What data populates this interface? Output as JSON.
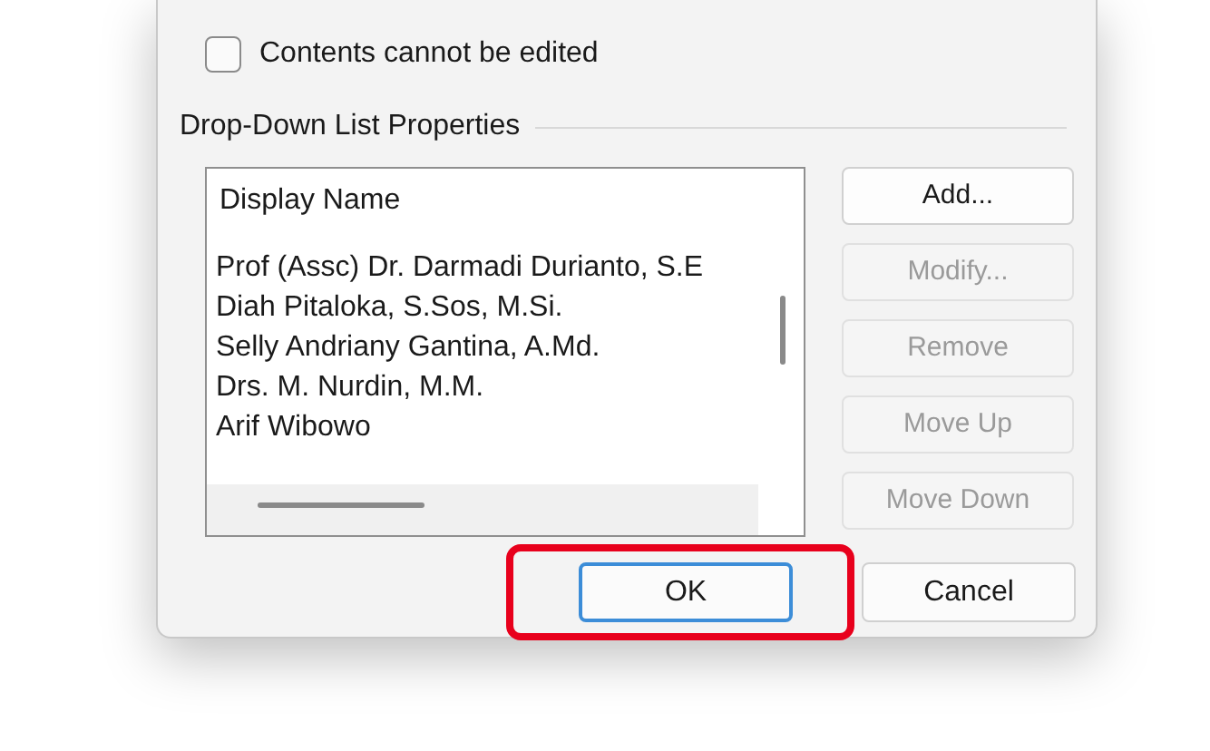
{
  "checkbox": {
    "label": "Contents cannot be edited",
    "checked": false
  },
  "group": {
    "title": "Drop-Down List Properties"
  },
  "list": {
    "header": "Display Name",
    "rows": [
      {
        "text": "Prof (Assc) Dr. Darmadi Durianto, S.E"
      },
      {
        "text": "Diah Pitaloka, S.Sos, M.Si."
      },
      {
        "text": "Selly Andriany Gantina, A.Md."
      },
      {
        "text": "Drs. M. Nurdin, M.M."
      },
      {
        "text": "Arif Wibowo"
      }
    ]
  },
  "side_buttons": [
    {
      "label": "Add...",
      "disabled": false
    },
    {
      "label": "Modify...",
      "disabled": true
    },
    {
      "label": "Remove",
      "disabled": true
    },
    {
      "label": "Move Up",
      "disabled": true
    },
    {
      "label": "Move Down",
      "disabled": true
    }
  ],
  "footer_buttons": [
    {
      "label": "OK",
      "default": true,
      "highlighted": true
    },
    {
      "label": "Cancel",
      "default": false,
      "highlighted": false
    }
  ]
}
